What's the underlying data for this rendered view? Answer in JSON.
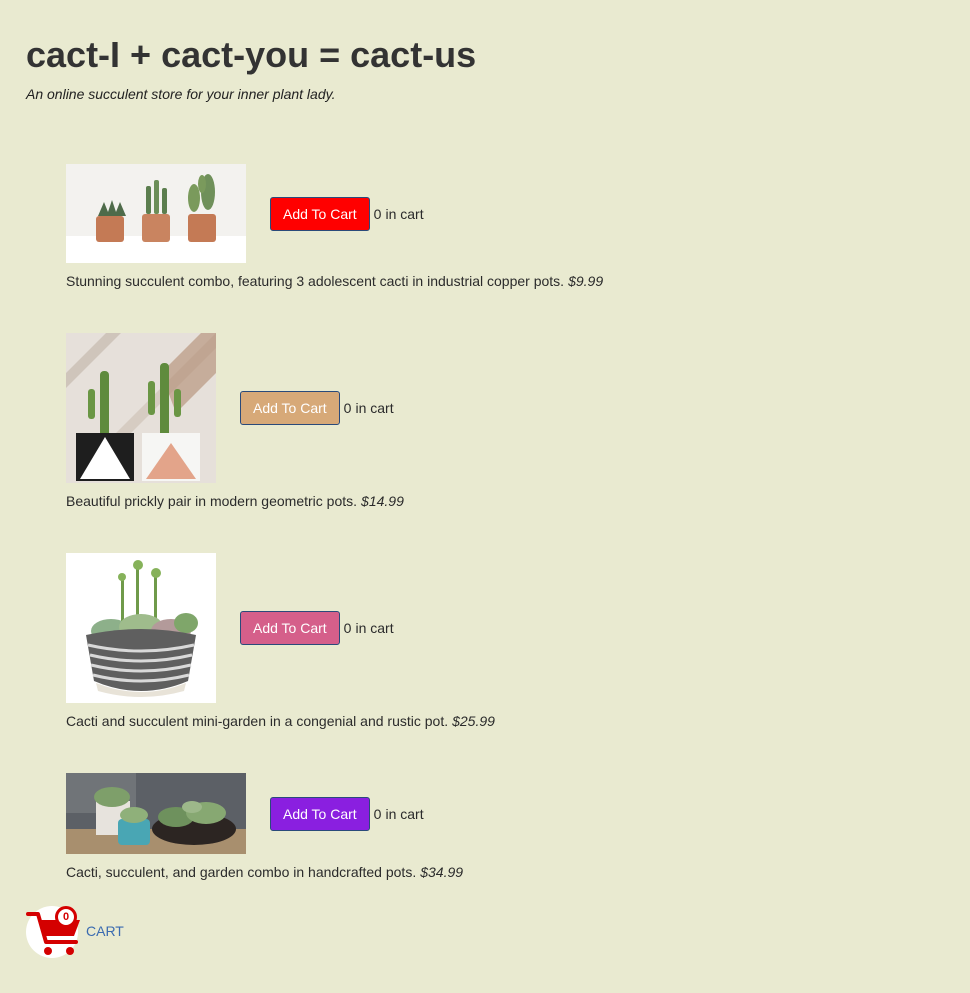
{
  "header": {
    "title": "cact-I + cact-you = cact-us",
    "subtitle": "An online succulent store for your inner plant lady."
  },
  "products": [
    {
      "button_label": "Add To Cart",
      "button_color": "#ff0000",
      "count": "0",
      "in_cart_label": "in cart",
      "description": "Stunning succulent combo, featuring 3 adolescent cacti in industrial copper pots.",
      "price": "$9.99",
      "image_icon": "copper-pots-cacti-photo"
    },
    {
      "button_label": "Add To Cart",
      "button_color": "#d7a978",
      "count": "0",
      "in_cart_label": "in cart",
      "description": "Beautiful prickly pair in modern geometric pots.",
      "price": "$14.99",
      "image_icon": "geometric-pots-cacti-photo"
    },
    {
      "button_label": "Add To Cart",
      "button_color": "#d55f8a",
      "count": "0",
      "in_cart_label": "in cart",
      "description": "Cacti and succulent mini-garden in a congenial and rustic pot.",
      "price": "$25.99",
      "image_icon": "mini-garden-bowl-photo"
    },
    {
      "button_label": "Add To Cart",
      "button_color": "#8a1fe0",
      "count": "0",
      "in_cart_label": "in cart",
      "description": "Cacti, succulent, and garden combo in handcrafted pots.",
      "price": "$34.99",
      "image_icon": "handcrafted-pots-photo"
    }
  ],
  "cart": {
    "count": "0",
    "label": "CART",
    "icon": "shopping-cart-icon",
    "icon_color": "#d40000",
    "link_color": "#3a6bb0"
  }
}
